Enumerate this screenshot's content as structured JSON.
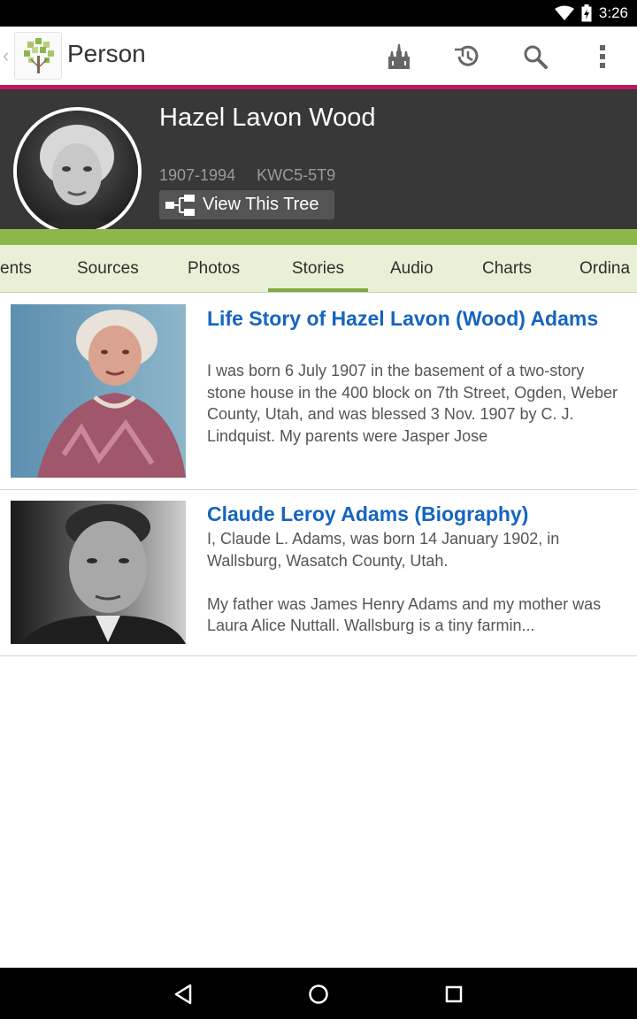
{
  "status_bar": {
    "time": "3:26"
  },
  "app_bar": {
    "title": "Person",
    "icons": [
      "up-chevron-icon",
      "family-tree-logo-icon",
      "temple-icon",
      "history-icon",
      "search-icon",
      "more-vert-icon"
    ]
  },
  "person": {
    "name": "Hazel Lavon Wood",
    "lifespan": "1907-1994",
    "pid": "KWC5-5T9",
    "view_tree_label": "View This Tree"
  },
  "tabs": [
    {
      "label": "ents",
      "active": false
    },
    {
      "label": "Sources",
      "active": false
    },
    {
      "label": "Photos",
      "active": false
    },
    {
      "label": "Stories",
      "active": true
    },
    {
      "label": "Audio",
      "active": false
    },
    {
      "label": "Charts",
      "active": false
    },
    {
      "label": "Ordina",
      "active": false
    }
  ],
  "stories": [
    {
      "title": "Life Story of Hazel Lavon (Wood) Adams",
      "excerpt": "I was born 6 July 1907 in the basement of a two-story stone house in the 400 block on 7th Street, Ogden, Weber County, Utah, and was blessed 3 Nov. 1907 by C. J. Lindquist. My parents were Jasper Jose"
    },
    {
      "title": "Claude Leroy Adams (Biography)",
      "excerpt": "I, Claude L. Adams, was born 14 January 1902, in Wallsburg, Wasatch County, Utah.\n\nMy father was James Henry Adams and my mother was Laura Alice Nuttall. Wallsburg is a tiny farmin..."
    }
  ],
  "colors": {
    "accent_pink": "#c2185b",
    "accent_green": "#8cb84a",
    "link_blue": "#1565c0",
    "header_bg": "#383838",
    "tabs_bg": "#eaf0d6"
  }
}
